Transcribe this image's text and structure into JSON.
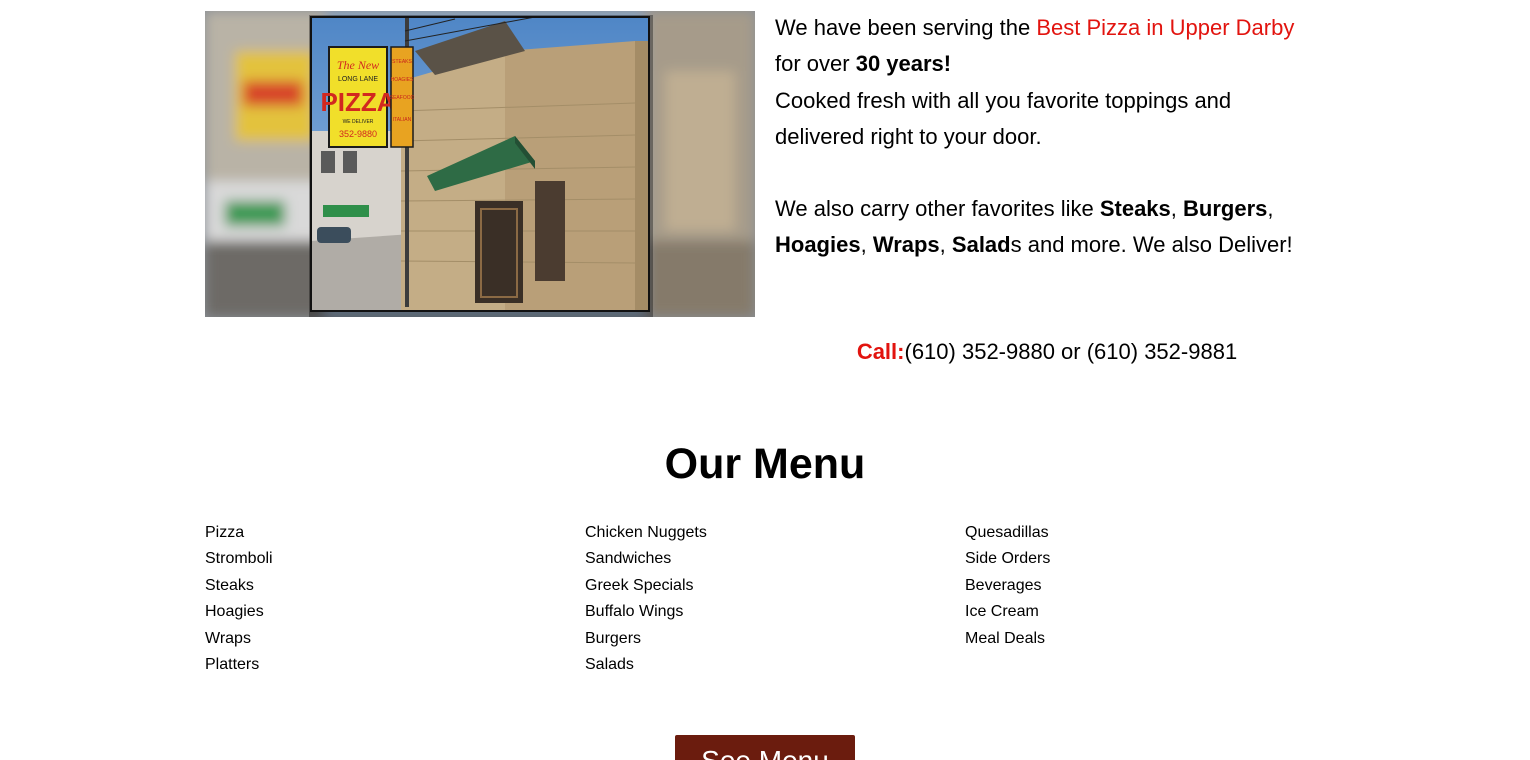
{
  "hero": {
    "sign": {
      "line1": "The New",
      "line2": "LONG LANE",
      "line3": "PIZZA",
      "line4": "WE DELIVER",
      "line5": "352-9880",
      "side1": "STEAKS",
      "side2": "HOAGIES",
      "side3": "SEAFOOD",
      "side4": "ITALIAN DISHES"
    }
  },
  "intro": {
    "p1_a": "We have been serving the ",
    "p1_highlight": "Best Pizza in Upper Darby",
    "p1_b": " for over ",
    "p1_bold": "30 years!",
    "p1_c": "Cooked fresh with all you favorite toppings and delivered right to your door.",
    "p2_a": "We also carry other favorites like ",
    "p2_item1": "Steaks",
    "p2_sep1": ", ",
    "p2_item2": "Burgers",
    "p2_sep2": ", ",
    "p2_item3": "Hoagies",
    "p2_sep3": ", ",
    "p2_item4": "Wraps",
    "p2_sep4": ", ",
    "p2_item5": "Salad",
    "p2_b": "s and more. We also Deliver!"
  },
  "call": {
    "label": "Call:",
    "numbers": "(610) 352-9880 or (610) 352-9881"
  },
  "menu": {
    "title": "Our Menu",
    "columns": [
      [
        "Pizza",
        "Stromboli",
        "Steaks",
        "Hoagies",
        "Wraps",
        "Platters"
      ],
      [
        "Chicken Nuggets",
        "Sandwiches",
        "Greek Specials",
        "Buffalo Wings",
        "Burgers",
        "Salads"
      ],
      [
        "Quesadillas",
        "Side Orders",
        "Beverages",
        "Ice Cream",
        "Meal Deals"
      ]
    ],
    "button_label": "See Menu"
  },
  "colors": {
    "accent_red": "#e2140f",
    "button_bg": "#6b1c0e"
  }
}
